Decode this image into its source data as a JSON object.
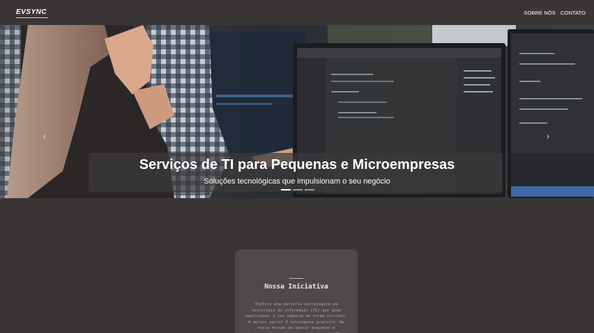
{
  "header": {
    "logo": "EVSYNC",
    "nav": [
      {
        "label": "SOBRE NÓS"
      },
      {
        "label": "CONTATO"
      }
    ]
  },
  "hero": {
    "title": "Serviços de TI para Pequenas e Microempresas",
    "subtitle": "Soluções tecnológicas que impulsionam o seu negócio",
    "prev_icon": "chevron-left-icon",
    "next_icon": "chevron-right-icon",
    "prev_glyph": "‹",
    "next_glyph": "›",
    "slides_count": 3,
    "active_slide": 1
  },
  "initiative": {
    "title": "Nossa Iniciativa",
    "text": "Explore uma parceria estratégica em tecnologia da informação (TI) que pode impulsionar o seu negócio de forma incrível. A melhor parte? É totalmente gratuito. Na nossa missão de apoiar pequenas e microempresas, oferecemos serviços de TI de"
  },
  "colors": {
    "background": "#3a3535",
    "navbar": "#3b3636",
    "card": "#4f4a4a",
    "text": "#ffffff"
  }
}
